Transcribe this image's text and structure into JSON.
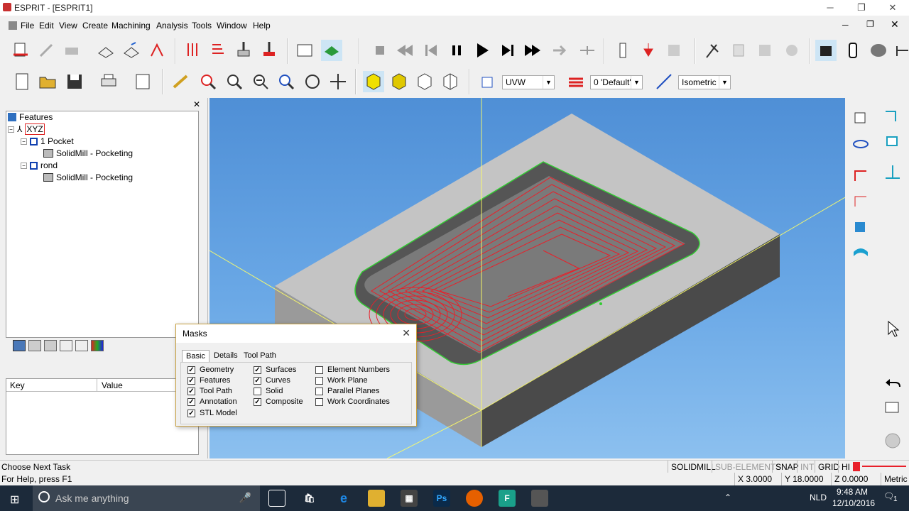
{
  "window": {
    "title": "ESPRIT - [ESPRIT1]"
  },
  "menu": [
    "File",
    "Edit",
    "View",
    "Create",
    "Machining",
    "Analysis",
    "Tools",
    "Window",
    "Help"
  ],
  "toolbar2": {
    "plane_combo": "UVW",
    "layer_combo": "0 'Default'",
    "view_combo": "Isometric"
  },
  "tree": {
    "header": "Features",
    "root": "XYZ",
    "items": [
      {
        "label": "1 Pocket",
        "child": "SolidMill - Pocketing"
      },
      {
        "label": "rond",
        "child": "SolidMill - Pocketing"
      }
    ]
  },
  "props": {
    "col_key": "Key",
    "col_value": "Value"
  },
  "masks": {
    "title": "Masks",
    "tabs": [
      "Basic",
      "Details",
      "Tool Path"
    ],
    "col1": [
      {
        "label": "Geometry",
        "checked": true
      },
      {
        "label": "Features",
        "checked": true
      },
      {
        "label": "Tool Path",
        "checked": true
      },
      {
        "label": "Annotation",
        "checked": true
      },
      {
        "label": "STL Model",
        "checked": true
      }
    ],
    "col2": [
      {
        "label": "Surfaces",
        "checked": true
      },
      {
        "label": "Curves",
        "checked": true
      },
      {
        "label": "Solid",
        "checked": false
      },
      {
        "label": "Composite",
        "checked": true
      }
    ],
    "col3": [
      {
        "label": "Element Numbers",
        "checked": false
      },
      {
        "label": "Work Plane",
        "checked": false
      },
      {
        "label": "Parallel Planes",
        "checked": false
      },
      {
        "label": "Work Coordinates",
        "checked": false
      }
    ]
  },
  "status": {
    "task": "Choose Next Task",
    "help": "For Help, press F1",
    "mode": "SOLIDMILL",
    "sub": "SUB-ELEMENTS",
    "snap": "SNAP",
    "int": "INT",
    "grid": "GRID",
    "hi": "HI",
    "x": "X 3.0000",
    "y": "Y 18.0000",
    "z": "Z 0.0000",
    "units": "Metric"
  },
  "taskbar": {
    "search_placeholder": "Ask me anything",
    "lang": "NLD",
    "time": "9:48 AM",
    "date": "12/10/2016",
    "notif_count": "1"
  },
  "colors": {
    "viewport_top": "#4f8fd6",
    "toolpath": "#e8202a",
    "edge": "#33cc33",
    "axis": "#ffff66"
  }
}
